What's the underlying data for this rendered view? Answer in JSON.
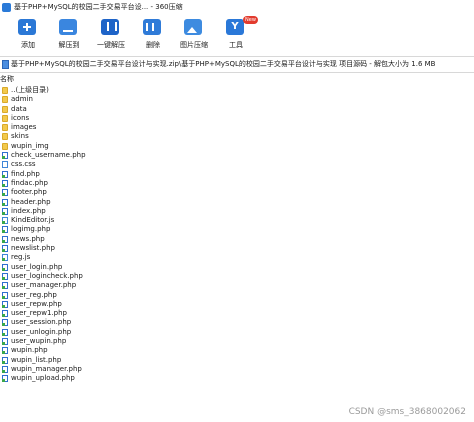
{
  "window": {
    "title": "基于PHP+MySQL的校园二手交易平台设... - 360压缩"
  },
  "toolbar": {
    "items": [
      {
        "label": "添加",
        "icon": "add-icon"
      },
      {
        "label": "解压到",
        "icon": "extract-icon"
      },
      {
        "label": "一键解压",
        "icon": "one-key-extract-icon"
      },
      {
        "label": "删除",
        "icon": "delete-icon"
      },
      {
        "label": "图片压缩",
        "icon": "image-compress-icon"
      },
      {
        "label": "工具",
        "icon": "tools-icon",
        "badge": "New"
      }
    ]
  },
  "path": {
    "text": "基于PHP+MySQL的校园二手交易平台设计与实现.zip\\基于PHP+MySQL的校园二手交易平台设计与实现 项目源码 - 解包大小为 1.6 MB"
  },
  "columns": {
    "name": "名称"
  },
  "files": [
    {
      "name": "..(上级目录)",
      "type": "up"
    },
    {
      "name": "admin",
      "type": "folder"
    },
    {
      "name": "data",
      "type": "folder"
    },
    {
      "name": "icons",
      "type": "folder"
    },
    {
      "name": "images",
      "type": "folder"
    },
    {
      "name": "skins",
      "type": "folder"
    },
    {
      "name": "wupin_img",
      "type": "folder"
    },
    {
      "name": "check_username.php",
      "type": "php"
    },
    {
      "name": "css.css",
      "type": "css"
    },
    {
      "name": "find.php",
      "type": "php"
    },
    {
      "name": "findac.php",
      "type": "php"
    },
    {
      "name": "footer.php",
      "type": "php"
    },
    {
      "name": "header.php",
      "type": "php"
    },
    {
      "name": "index.php",
      "type": "php"
    },
    {
      "name": "KindEditor.js",
      "type": "js"
    },
    {
      "name": "logimg.php",
      "type": "php"
    },
    {
      "name": "news.php",
      "type": "php"
    },
    {
      "name": "newslist.php",
      "type": "php"
    },
    {
      "name": "reg.js",
      "type": "js"
    },
    {
      "name": "user_login.php",
      "type": "php"
    },
    {
      "name": "user_logincheck.php",
      "type": "php"
    },
    {
      "name": "user_manager.php",
      "type": "php"
    },
    {
      "name": "user_reg.php",
      "type": "php"
    },
    {
      "name": "user_repw.php",
      "type": "php"
    },
    {
      "name": "user_repw1.php",
      "type": "php"
    },
    {
      "name": "user_session.php",
      "type": "php"
    },
    {
      "name": "user_unlogin.php",
      "type": "php"
    },
    {
      "name": "user_wupin.php",
      "type": "php"
    },
    {
      "name": "wupin.php",
      "type": "php"
    },
    {
      "name": "wupin_list.php",
      "type": "php"
    },
    {
      "name": "wupin_manager.php",
      "type": "php"
    },
    {
      "name": "wupin_upload.php",
      "type": "php"
    }
  ],
  "watermark": "CSDN @sms_3868002062",
  "colors": {
    "accent": "#2b78d6",
    "folder": "#f2c94c",
    "badge": "#e23b2e"
  }
}
